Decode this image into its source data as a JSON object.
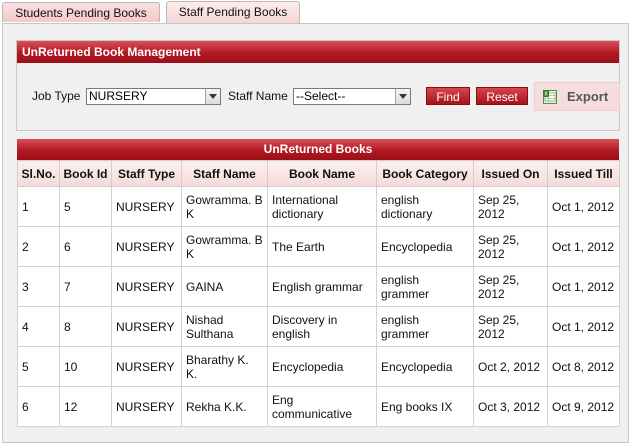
{
  "tabs": [
    {
      "label": "Students Pending Books"
    },
    {
      "label": "Staff Pending Books"
    }
  ],
  "management": {
    "title": "UnReturned Book Management",
    "job_type_label": "Job Type",
    "job_type_value": "NURSERY",
    "staff_name_label": "Staff Name",
    "staff_name_value": "--Select--",
    "find_label": "Find",
    "reset_label": "Reset",
    "export_label": "Export"
  },
  "table": {
    "title": "UnReturned Books",
    "columns": [
      "Sl.No.",
      "Book Id",
      "Staff Type",
      "Staff Name",
      "Book Name",
      "Book Category",
      "Issued On",
      "Issued Till"
    ],
    "rows": [
      [
        "1",
        "5",
        "NURSERY",
        "Gowramma. B K",
        "International dictionary",
        "english dictionary",
        "Sep 25, 2012",
        "Oct 1, 2012"
      ],
      [
        "2",
        "6",
        "NURSERY",
        "Gowramma. B K",
        "The Earth",
        "Encyclopedia",
        "Sep 25, 2012",
        "Oct 1, 2012"
      ],
      [
        "3",
        "7",
        "NURSERY",
        "GAINA",
        "English grammar",
        "english grammer",
        "Sep 25, 2012",
        "Oct 1, 2012"
      ],
      [
        "4",
        "8",
        "NURSERY",
        "Nishad Sulthana",
        "Discovery in english",
        "english grammer",
        "Sep 25, 2012",
        "Oct 1, 2012"
      ],
      [
        "5",
        "10",
        "NURSERY",
        "Bharathy K. K.",
        "Encyclopedia",
        "Encyclopedia",
        "Oct 2, 2012",
        "Oct 8, 2012"
      ],
      [
        "6",
        "12",
        "NURSERY",
        "Rekha K.K.",
        "Eng communicative",
        "Eng books IX",
        "Oct 3, 2012",
        "Oct 9, 2012"
      ]
    ]
  },
  "colors": {
    "header_red": "#b21822",
    "tab_pink": "#f3c9c9",
    "column_header_pink": "#f4d9d9"
  },
  "icons": {
    "export": "excel-icon",
    "dropdown": "chevron-down-icon"
  }
}
